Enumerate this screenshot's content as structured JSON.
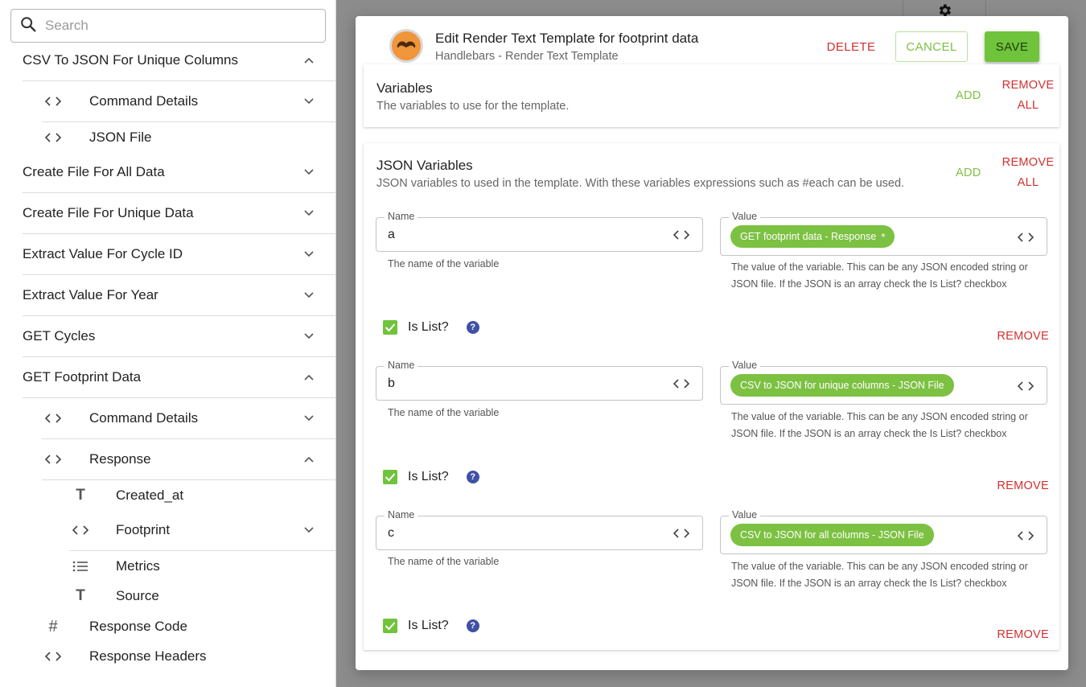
{
  "sidebar": {
    "search_placeholder": "Search",
    "items": [
      {
        "label": "CSV To JSON For Unique Columns",
        "chevron": "up"
      },
      {
        "icon": "<>",
        "label": "Command Details",
        "chevron": "down"
      },
      {
        "icon": "<>",
        "label": "JSON File"
      },
      {
        "label": "Create File For All Data",
        "chevron": "down"
      },
      {
        "label": "Create File For Unique Data",
        "chevron": "down"
      },
      {
        "label": "Extract Value For Cycle ID",
        "chevron": "down"
      },
      {
        "label": "Extract Value For Year",
        "chevron": "down"
      },
      {
        "label": "GET Cycles",
        "chevron": "down"
      },
      {
        "label": "GET Footprint Data",
        "chevron": "up"
      },
      {
        "icon": "<>",
        "label": "Command Details",
        "chevron": "down"
      },
      {
        "icon": "<>",
        "label": "Response",
        "chevron": "up"
      },
      {
        "icon": "T",
        "label": "Created_at"
      },
      {
        "icon": "<>",
        "label": "Footprint",
        "chevron": "down"
      },
      {
        "icon": "list",
        "label": "Metrics"
      },
      {
        "icon": "T",
        "label": "Source"
      },
      {
        "icon": "#",
        "label": "Response Code"
      },
      {
        "icon": "<>",
        "label": "Response Headers"
      }
    ]
  },
  "modal": {
    "title": "Edit Render Text Template for footprint data",
    "subtitle": "Handlebars - Render Text Template",
    "delete_label": "DELETE",
    "cancel_label": "CANCEL",
    "save_label": "SAVE",
    "variables": {
      "title": "Variables",
      "description": "The variables to use for the template.",
      "add_label": "ADD",
      "remove_all_label_1": "REMOVE",
      "remove_all_label_2": "ALL"
    },
    "json_variables": {
      "title": "JSON Variables",
      "description": "JSON variables to used in the template. With these variables expressions such as #each can be used.",
      "add_label": "ADD",
      "remove_all_label_1": "REMOVE",
      "remove_all_label_2": "ALL",
      "name_legend": "Name",
      "value_legend": "Value",
      "name_helper": "The name of the variable",
      "value_helper_1": "The value of the variable. This can be any JSON encoded string or",
      "value_helper_2": "JSON file. If the JSON is an array check the Is List? checkbox",
      "is_list_label": "Is List?",
      "help_glyph": "?",
      "remove_label": "REMOVE",
      "entries": [
        {
          "name": "a",
          "value_chip": "GET footprint data - Response",
          "chip_marker": "*",
          "is_list": true
        },
        {
          "name": "b",
          "value_chip": "CSV to JSON for unique columns - JSON File",
          "is_list": true
        },
        {
          "name": "c",
          "value_chip": "CSV to JSON for all columns - JSON File",
          "is_list": true
        }
      ]
    }
  },
  "colors": {
    "accent_green": "#7cc142",
    "danger_red": "#d32f2f",
    "help_blue": "#3f51a5",
    "logo_orange": "#f0953a"
  }
}
